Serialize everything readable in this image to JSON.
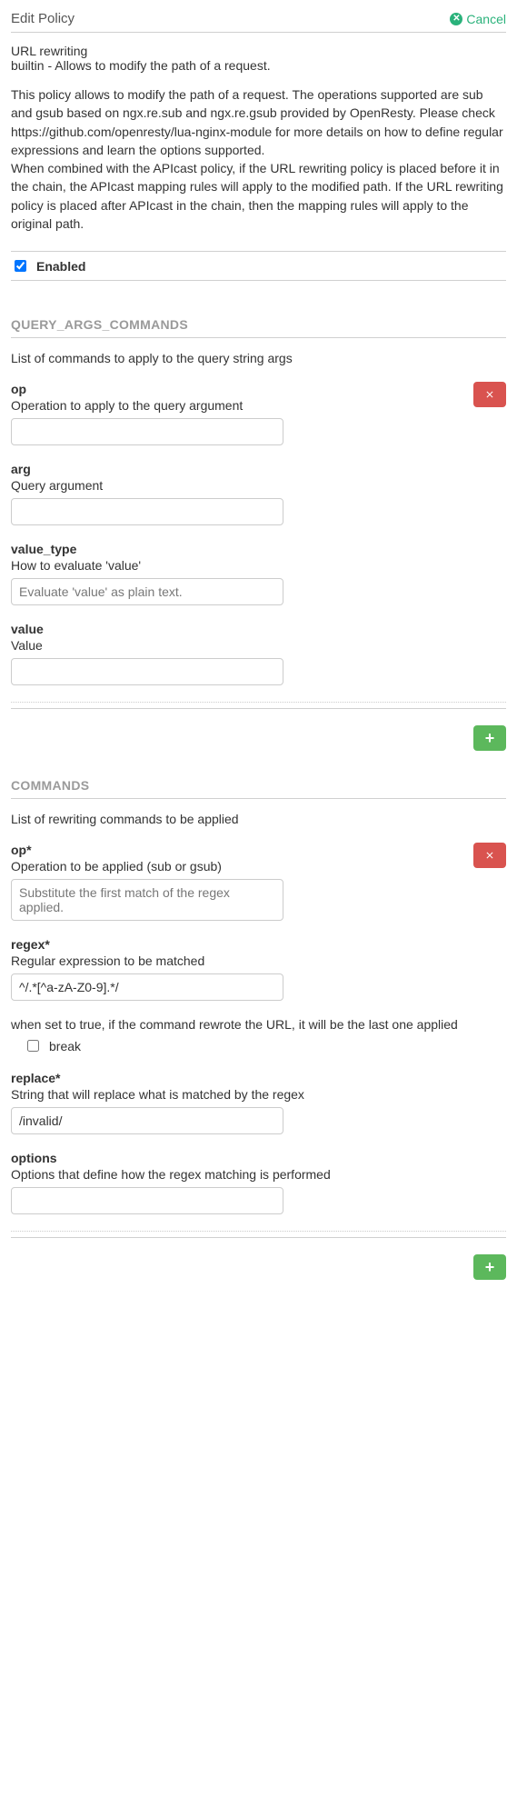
{
  "header": {
    "title": "Edit Policy",
    "cancel": "Cancel"
  },
  "policy": {
    "name": "URL rewriting",
    "builtin": "builtin - Allows to modify the path of a request.",
    "description": "This policy allows to modify the path of a request. The operations supported are sub and gsub based on ngx.re.sub and ngx.re.gsub provided by OpenResty. Please check https://github.com/openresty/lua-nginx-module for more details on how to define regular expressions and learn the options supported.\nWhen combined with the APIcast policy, if the URL rewriting policy is placed before it in the chain, the APIcast mapping rules will apply to the modified path. If the URL rewriting policy is placed after APIcast in the chain, then the mapping rules will apply to the original path."
  },
  "enabled": {
    "label": "Enabled",
    "checked": true
  },
  "query_args": {
    "section_title": "QUERY_ARGS_COMMANDS",
    "section_desc": "List of commands to apply to the query string args",
    "fields": {
      "op": {
        "label": "op",
        "help": "Operation to apply to the query argument",
        "value": ""
      },
      "arg": {
        "label": "arg",
        "help": "Query argument",
        "value": ""
      },
      "value_type": {
        "label": "value_type",
        "help": "How to evaluate 'value'",
        "selected": "Evaluate 'value' as plain text."
      },
      "value": {
        "label": "value",
        "help": "Value",
        "value": ""
      }
    }
  },
  "commands": {
    "section_title": "COMMANDS",
    "section_desc": "List of rewriting commands to be applied",
    "fields": {
      "op": {
        "label": "op*",
        "help": "Operation to be applied (sub or gsub)",
        "selected": "Substitute the first match of the regex applied."
      },
      "regex": {
        "label": "regex*",
        "help": "Regular expression to be matched",
        "value": "^/.*[^a-zA-Z0-9].*/"
      },
      "break": {
        "help": "when set to true, if the command rewrote the URL, it will be the last one applied",
        "label": "break",
        "checked": false
      },
      "replace": {
        "label": "replace*",
        "help": "String that will replace what is matched by the regex",
        "value": "/invalid/"
      },
      "options": {
        "label": "options",
        "help": "Options that define how the regex matching is performed",
        "value": ""
      }
    }
  }
}
